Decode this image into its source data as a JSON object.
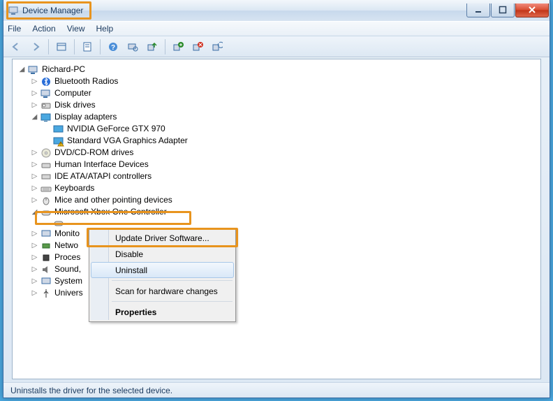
{
  "window": {
    "title": "Device Manager"
  },
  "menubar": {
    "file": "File",
    "action": "Action",
    "view": "View",
    "help": "Help"
  },
  "tree": {
    "root": "Richard-PC",
    "bluetooth": "Bluetooth Radios",
    "computer": "Computer",
    "disk": "Disk drives",
    "display": "Display adapters",
    "gtx": "NVIDIA GeForce GTX 970",
    "vga": "Standard VGA Graphics Adapter",
    "dvd": "DVD/CD-ROM drives",
    "hid": "Human Interface Devices",
    "ide": "IDE ATA/ATAPI controllers",
    "keyboard": "Keyboards",
    "mice": "Mice and other pointing devices",
    "xbox": "Microsoft Xbox One Controller",
    "monitor": "Monito",
    "network": "Netwo",
    "processors": "Proces",
    "sound": "Sound,",
    "system": "System",
    "usb": "Univers"
  },
  "context_menu": {
    "update": "Update Driver Software...",
    "disable": "Disable",
    "uninstall": "Uninstall",
    "scan": "Scan for hardware changes",
    "properties": "Properties"
  },
  "statusbar": {
    "text": "Uninstalls the driver for the selected device."
  },
  "highlight_color": "#e8941e"
}
